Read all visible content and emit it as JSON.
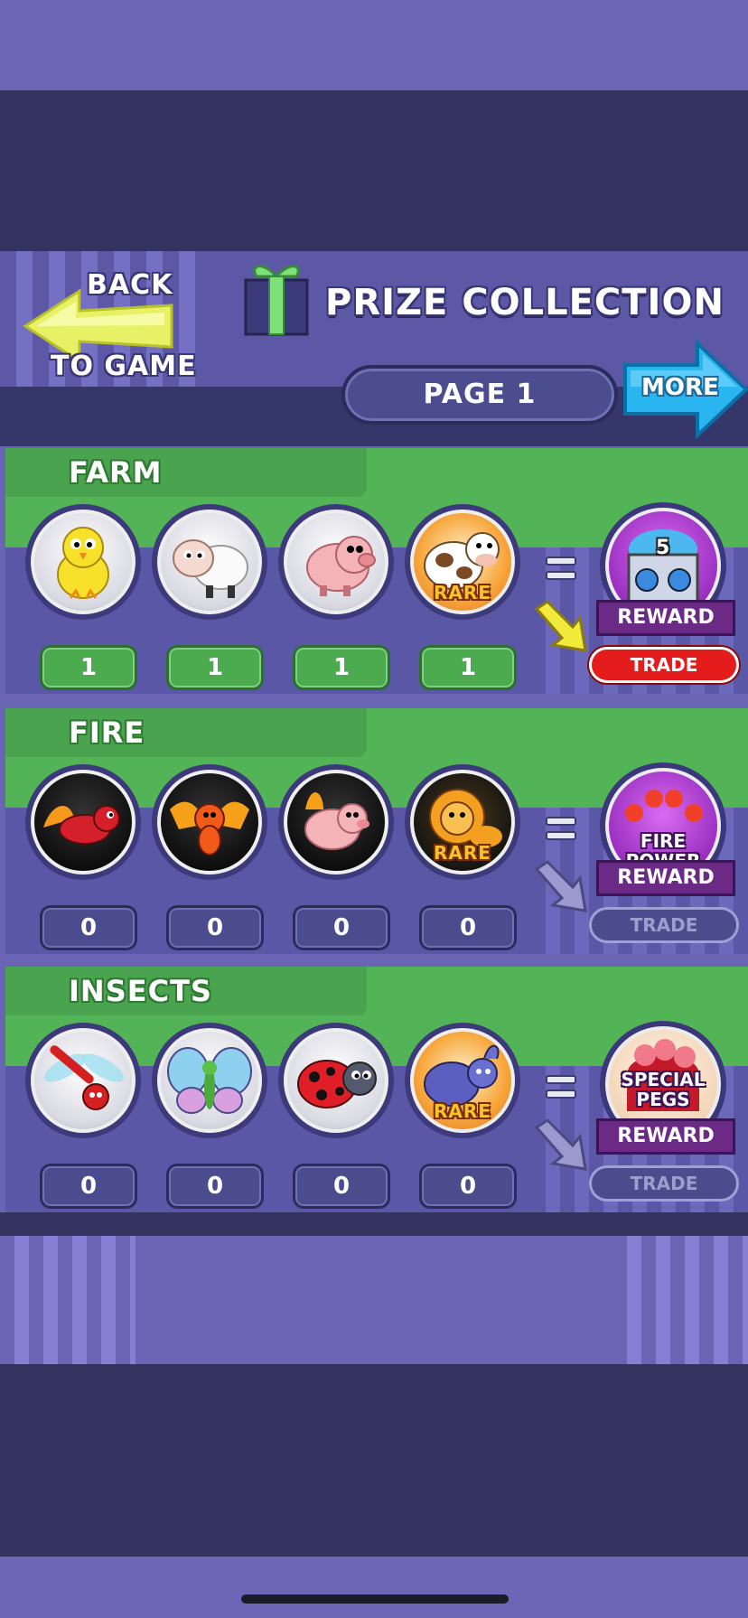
{
  "header": {
    "back_top": "BACK",
    "back_bottom": "TO GAME",
    "title": "PRIZE COLLECTION",
    "page_label": "PAGE 1",
    "more_label": "MORE"
  },
  "collections": [
    {
      "name": "FARM",
      "items": [
        {
          "icon": "chick-icon",
          "count": "1",
          "rare": ""
        },
        {
          "icon": "sheep-icon",
          "count": "1",
          "rare": ""
        },
        {
          "icon": "pig-icon",
          "count": "1",
          "rare": ""
        },
        {
          "icon": "cow-icon",
          "count": "1",
          "rare": "RARE"
        }
      ],
      "reward_banner": "REWARD",
      "reward_badge": "5",
      "trade": "TRADE",
      "trade_state": "active"
    },
    {
      "name": "FIRE",
      "items": [
        {
          "icon": "fire-lizard-icon",
          "count": "0",
          "rare": ""
        },
        {
          "icon": "phoenix-icon",
          "count": "0",
          "rare": ""
        },
        {
          "icon": "fire-pig-icon",
          "count": "0",
          "rare": ""
        },
        {
          "icon": "fire-lion-icon",
          "count": "0",
          "rare": "RARE"
        }
      ],
      "reward_line1": "FIRE",
      "reward_line2": "POWER",
      "reward_banner": "REWARD",
      "trade": "TRADE",
      "trade_state": "inactive"
    },
    {
      "name": "INSECTS",
      "items": [
        {
          "icon": "dragonfly-icon",
          "count": "0",
          "rare": ""
        },
        {
          "icon": "butterfly-icon",
          "count": "0",
          "rare": ""
        },
        {
          "icon": "ladybug-icon",
          "count": "0",
          "rare": ""
        },
        {
          "icon": "beetle-icon",
          "count": "0",
          "rare": "RARE"
        }
      ],
      "reward_line1": "SPECIAL",
      "reward_line2": "PEGS",
      "reward_banner": "REWARD",
      "trade": "TRADE",
      "trade_state": "inactive"
    }
  ],
  "colors": {
    "green": "#53b457",
    "purple": "#5a58a6",
    "dark": "#33335f",
    "trade_red": "#e41c1c"
  }
}
